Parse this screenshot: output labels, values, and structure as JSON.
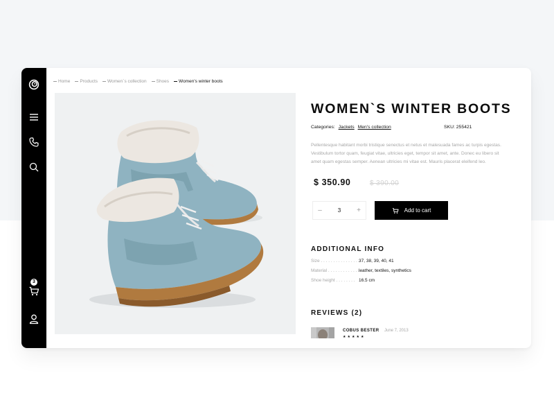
{
  "nav": {
    "items": [
      {
        "icon": "logo-icon"
      },
      {
        "icon": "menu-icon"
      },
      {
        "icon": "phone-icon"
      },
      {
        "icon": "search-icon"
      },
      {
        "icon": "cart-icon"
      },
      {
        "icon": "user-icon"
      }
    ],
    "cart_count": "3"
  },
  "breadcrumb": [
    "Home",
    "Products",
    "Women`s collection",
    "Shoes",
    "Women's winter boots"
  ],
  "product": {
    "title": "WOMEN`S WINTER BOOTS",
    "categories_label": "Categories:",
    "categories": [
      "Jackets",
      "Men's collection"
    ],
    "sku_label": "SKU:",
    "sku": "255421",
    "description": "Pellentesque habitant morbi tristique senectus et netus et malesuada fames ac turpis egestas. Vestibulum tortor quam, feugiat vitae, ultricies eget, tempor sit amet, ante. Donec eu libero sit amet quam egestas semper. Aenean ultricies mi vitae est. Mauris placerat eleifend leo.",
    "price": "$ 350.90",
    "old_price": "$ 390.00",
    "quantity": "3",
    "qty_minus": "–",
    "qty_plus": "+",
    "add_to_cart": "Add to cart"
  },
  "additional_info": {
    "title": "ADDITIONAL INFO",
    "rows": [
      {
        "label": "Size . . . . . . . . . . . . . . . .",
        "value": "37, 38, 39, 40, 41"
      },
      {
        "label": "Material . . . . . . . . . . . . .",
        "value": "leather, textiles, synthetics"
      },
      {
        "label": "Shoe height . . . . . . . .",
        "value": "16.5 cm"
      }
    ]
  },
  "reviews": {
    "title": "REVIEWS (2)",
    "items": [
      {
        "name": "COBUS BESTER",
        "date": "June 7, 2013",
        "stars": 5
      }
    ]
  },
  "colors": {
    "accent": "#000000",
    "boot": "#8fb3c1",
    "boot_dark": "#6f95a3",
    "fur": "#ece7e1",
    "sole": "#b07a3f"
  }
}
